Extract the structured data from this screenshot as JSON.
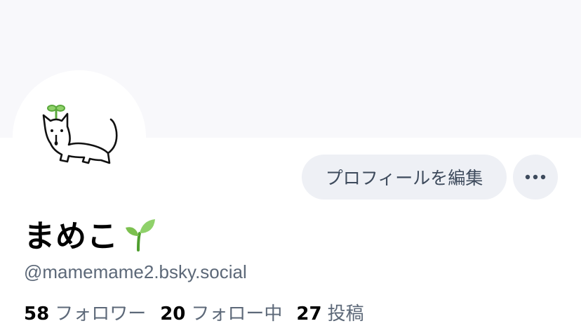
{
  "profile": {
    "display_name": "まめこ",
    "handle": "@mamemame2.bsky.social",
    "edit_profile_label": "プロフィールを編集",
    "more_options_icon": "ellipsis-icon",
    "name_emoji_icon": "seedling-icon"
  },
  "stats": {
    "followers": {
      "count": "58",
      "label": "フォロワー"
    },
    "following": {
      "count": "20",
      "label": "フォロー中"
    },
    "posts": {
      "count": "27",
      "label": "投稿"
    }
  },
  "colors": {
    "banner": "#f8f8fb",
    "button_bg": "#eef0f5",
    "button_text": "#3d4a5c",
    "muted_text": "#5c6878",
    "sprout": "#6dbb4a"
  }
}
